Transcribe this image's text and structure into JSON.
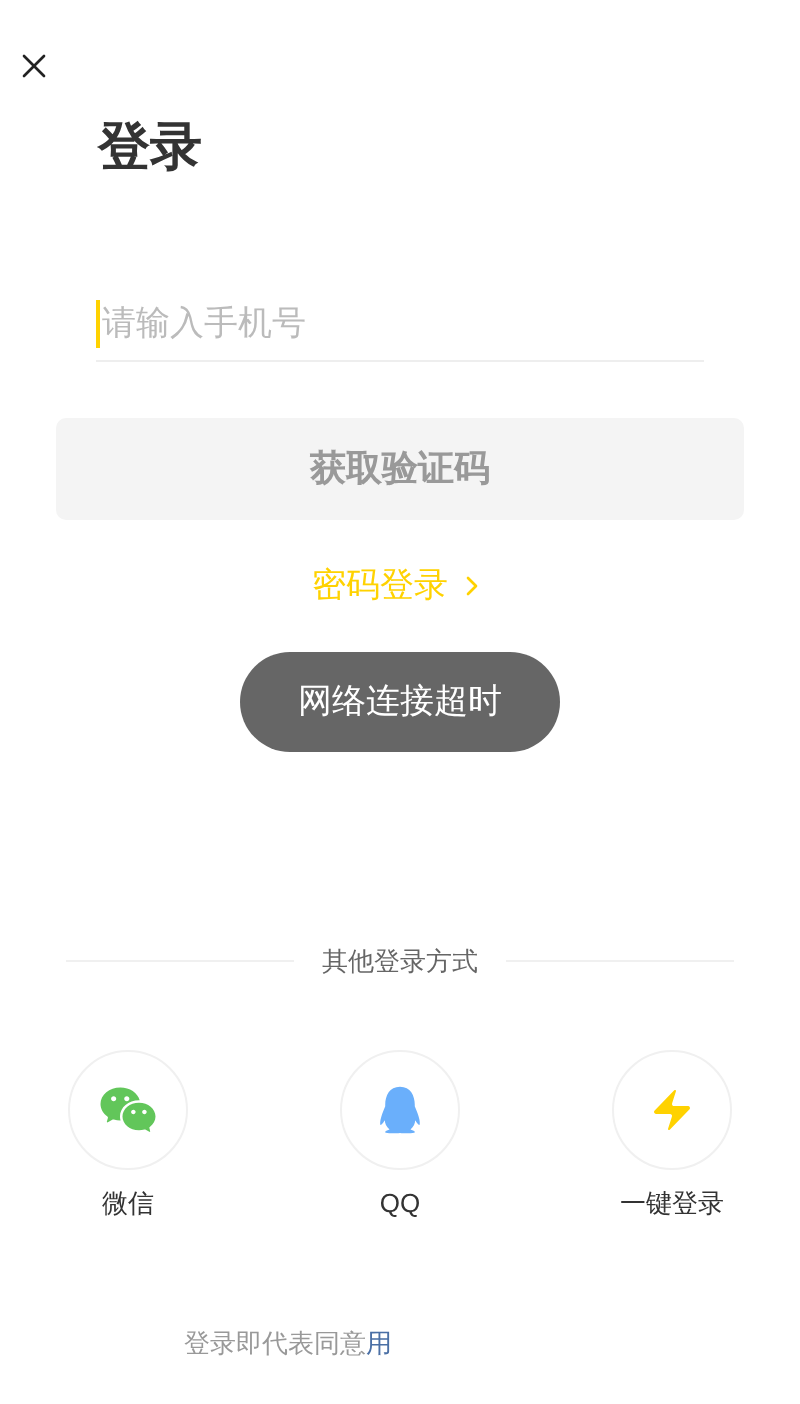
{
  "title": "登录",
  "phone_field": {
    "placeholder": "请输入手机号"
  },
  "get_code_button": {
    "label": "获取验证码",
    "disabled": true
  },
  "password_login_link": {
    "label": "密码登录"
  },
  "toast": {
    "message": "网络连接超时"
  },
  "other_methods": {
    "heading": "其他登录方式",
    "items": [
      {
        "kind": "wechat",
        "label": "微信"
      },
      {
        "kind": "qq",
        "label": "QQ"
      },
      {
        "kind": "one_tap",
        "label": "一键登录"
      }
    ]
  },
  "agreement": {
    "text": "登录即代表同意",
    "link": "用"
  }
}
